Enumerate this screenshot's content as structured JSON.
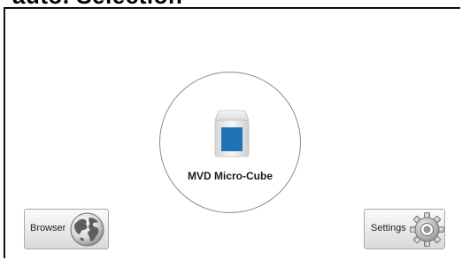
{
  "header": {
    "partial_title": "auto. Selection"
  },
  "device": {
    "label": "MVD Micro-Cube",
    "icon": "micro-cube-device-icon",
    "accent_color": "#1f73b7"
  },
  "buttons": {
    "browser": {
      "label": "Browser",
      "icon": "globe-icon"
    },
    "settings": {
      "label": "Settings",
      "icon": "gear-icon"
    }
  }
}
